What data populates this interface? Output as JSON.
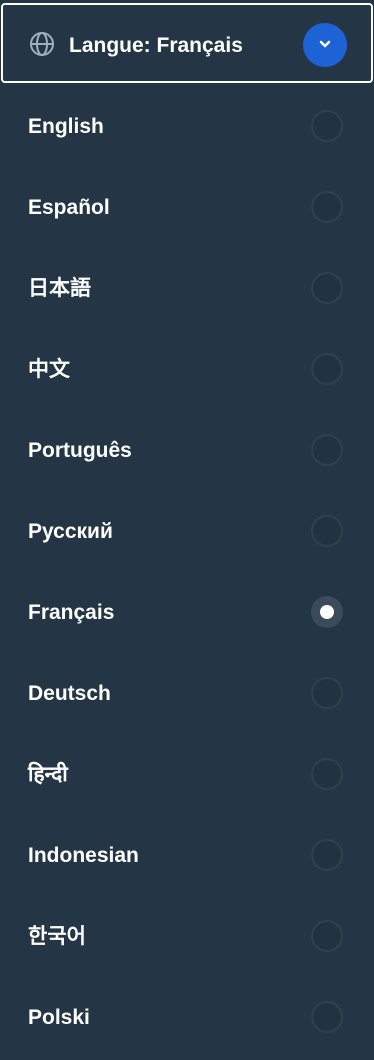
{
  "header": {
    "label": "Langue: Français",
    "globe_icon": "globe-icon",
    "toggle_icon": "chevron-down-icon",
    "toggle_color": "#1e63d6"
  },
  "languages": [
    {
      "label": "English",
      "selected": false
    },
    {
      "label": "Español",
      "selected": false
    },
    {
      "label": "日本語",
      "selected": false
    },
    {
      "label": "中文",
      "selected": false
    },
    {
      "label": "Português",
      "selected": false
    },
    {
      "label": "Русский",
      "selected": false
    },
    {
      "label": "Français",
      "selected": true
    },
    {
      "label": "Deutsch",
      "selected": false
    },
    {
      "label": "हिन्दी",
      "selected": false
    },
    {
      "label": "Indonesian",
      "selected": false
    },
    {
      "label": "한국어",
      "selected": false
    },
    {
      "label": "Polski",
      "selected": false
    }
  ],
  "colors": {
    "background": "#243545",
    "text": "#ffffff",
    "radio_border": "#31404f",
    "radio_checked_fill": "#3b4b5b"
  }
}
